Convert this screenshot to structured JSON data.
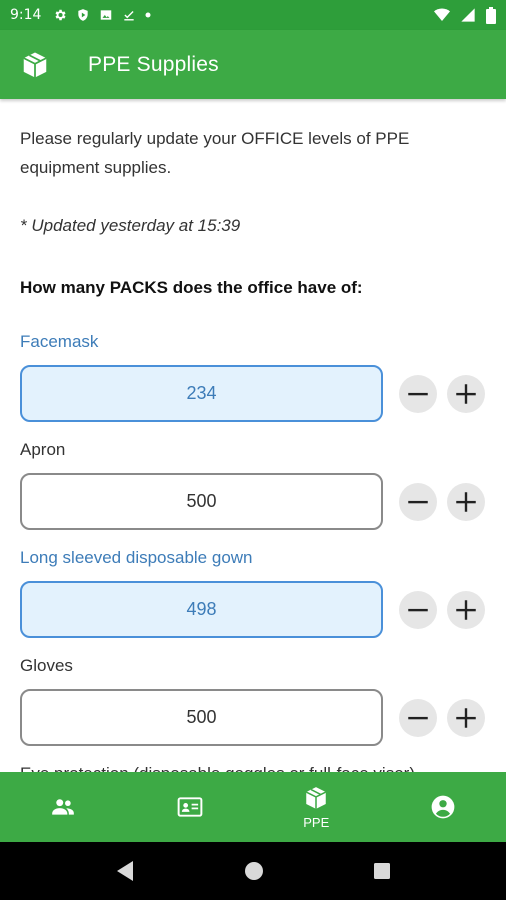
{
  "status_bar": {
    "time": "9:14",
    "left_icons": [
      "gear-icon",
      "shield-play-icon",
      "image-icon",
      "download-done-icon",
      "dot-icon"
    ],
    "right_icons": [
      "wifi-icon",
      "signal-icon",
      "battery-icon"
    ]
  },
  "app_bar": {
    "title": "PPE Supplies",
    "logo_icon": "package-icon"
  },
  "intro_text": "Please regularly update your OFFICE levels of PPE equipment supplies.",
  "updated_text": "* Updated yesterday at 15:39",
  "question_text": "How many PACKS does the office have of:",
  "items": [
    {
      "label": "Facemask",
      "value": "234",
      "active": true
    },
    {
      "label": "Apron",
      "value": "500",
      "active": false
    },
    {
      "label": "Long sleeved disposable gown",
      "value": "498",
      "active": true
    },
    {
      "label": "Gloves",
      "value": "500",
      "active": false
    },
    {
      "label": "Eye protection (disposable goggles or full-face visor)",
      "value": "",
      "active": false
    }
  ],
  "bottom_nav": [
    {
      "icon": "people-icon",
      "label": ""
    },
    {
      "icon": "id-card-icon",
      "label": ""
    },
    {
      "icon": "package-icon",
      "label": "PPE"
    },
    {
      "icon": "account-circle-icon",
      "label": ""
    }
  ],
  "system_nav": [
    "back-icon",
    "home-icon",
    "recents-icon"
  ],
  "colors": {
    "primary": "#3daa45",
    "status_bar": "#2e9e3a",
    "active_label": "#3d7cb8",
    "active_input_bg": "#e3f2fd"
  }
}
